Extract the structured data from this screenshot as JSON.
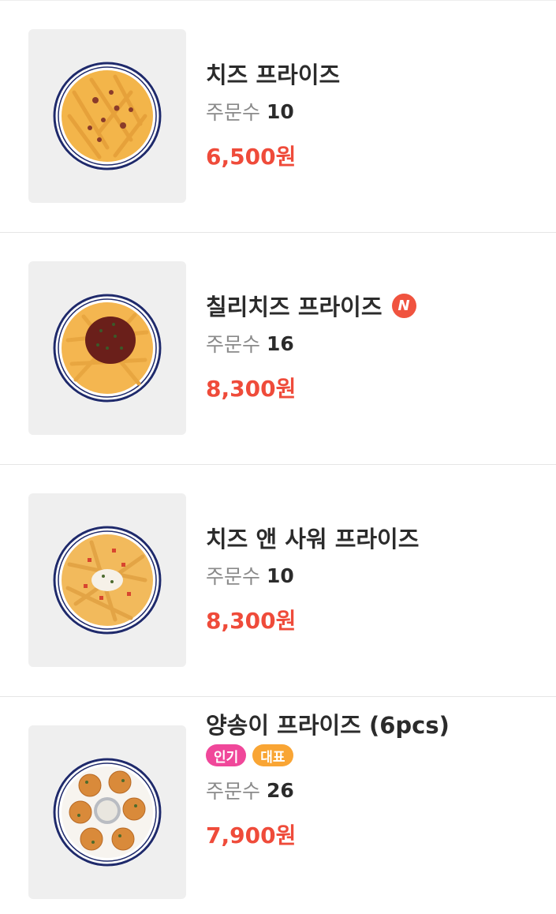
{
  "colors": {
    "price": "#ef4b3a",
    "new_badge": "#f0533f",
    "popular_badge": "#f0479a",
    "signature_badge": "#f9a534"
  },
  "items": [
    {
      "name": "치즈 프라이즈",
      "order_label": "주문수",
      "order_count": "10",
      "price": "6,500원",
      "image_icon": "cheese-fries-plate"
    },
    {
      "name": "칠리치즈 프라이즈",
      "new_badge": "N",
      "order_label": "주문수",
      "order_count": "16",
      "price": "8,300원",
      "image_icon": "chili-cheese-fries-plate"
    },
    {
      "name": "치즈 앤 사워 프라이즈",
      "order_label": "주문수",
      "order_count": "10",
      "price": "8,300원",
      "image_icon": "cheese-sour-fries-plate"
    },
    {
      "name": "양송이 프라이즈 (6pcs)",
      "badges": [
        "인기",
        "대표"
      ],
      "order_label": "주문수",
      "order_count": "26",
      "price": "7,900원",
      "image_icon": "mushroom-fries-plate"
    }
  ]
}
